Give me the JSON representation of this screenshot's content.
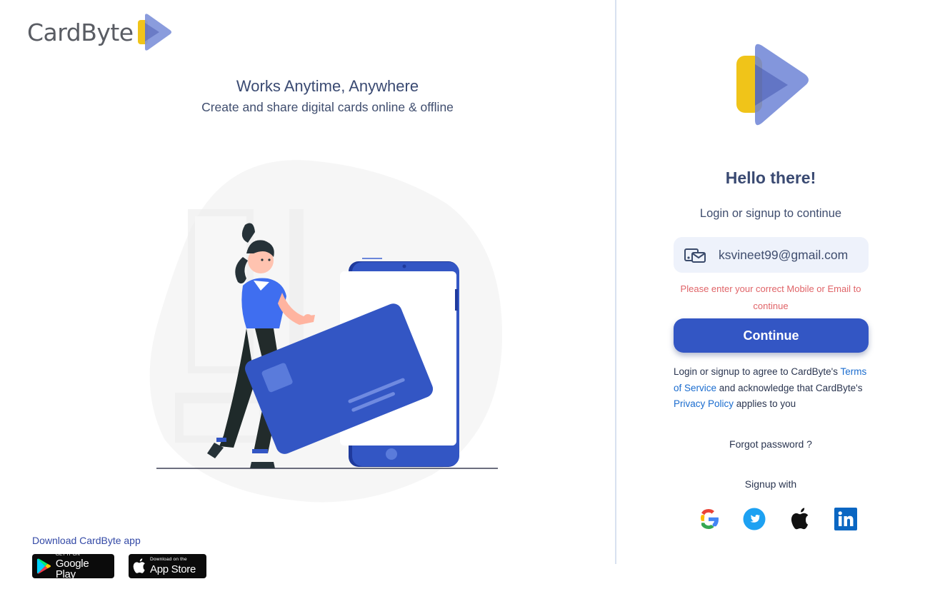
{
  "brand": {
    "name_part1": "Card",
    "name_part2": "Byte"
  },
  "hero": {
    "title": "Works Anytime, Anywhere",
    "subtitle": "Create and share digital cards online & offline"
  },
  "download": {
    "label": "Download CardByte app",
    "google_play_small": "GET IT ON",
    "google_play_big": "Google Play",
    "app_store_small": "Download on the",
    "app_store_big": "App Store"
  },
  "login": {
    "greeting": "Hello there!",
    "subtitle": "Login or signup to continue",
    "input_value": "ksvineet99@gmail.com",
    "error": "Please enter your correct Mobile or Email to continue",
    "continue_label": "Continue",
    "terms_prefix": "Login or signup to agree to CardByte's",
    "terms_link": "Terms of Service",
    "terms_middle": "and acknowledge that CardByte's",
    "privacy_link": "Privacy Policy",
    "terms_suffix": "applies to you",
    "forgot_label": "Forgot password ?",
    "signup_with": "Signup with"
  },
  "social": [
    "google-icon",
    "twitter-icon",
    "apple-icon",
    "linkedin-icon"
  ],
  "colors": {
    "primary": "#3356c4",
    "error": "#e06468",
    "link": "#1a6ccf",
    "logo_yellow": "#f0c419",
    "logo_blue": "#7d91d9"
  }
}
